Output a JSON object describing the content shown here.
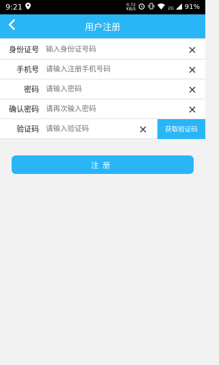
{
  "status_bar": {
    "time": "9:21",
    "net_speed": "0.72",
    "net_unit": "KB/S",
    "signal_label": "2G",
    "battery": "91%"
  },
  "header": {
    "title": "用户注册",
    "back_icon": "chevron-left-icon"
  },
  "form": {
    "fields": [
      {
        "label": "身份证号",
        "placeholder": "输入身份证号码"
      },
      {
        "label": "手机号",
        "placeholder": "请输入注册手机号码"
      },
      {
        "label": "密码",
        "placeholder": "请输入密码"
      },
      {
        "label": "确认密码",
        "placeholder": "请再次输入密码"
      },
      {
        "label": "验证码",
        "placeholder": "请输入验证码"
      }
    ],
    "get_code_label": "获取验证码"
  },
  "register_label": "注册",
  "colors": {
    "accent": "#29b6f6",
    "background": "#f2f2f2"
  }
}
